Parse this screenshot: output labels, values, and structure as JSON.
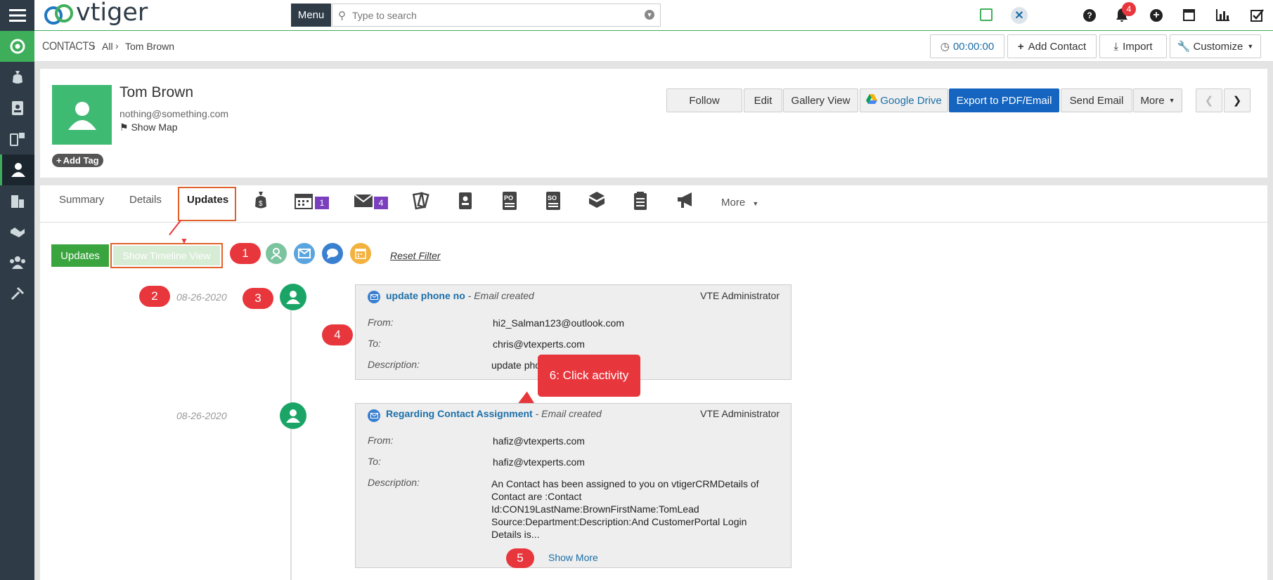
{
  "app": {
    "logo_text": "vtiger",
    "menu_label": "Menu",
    "search_placeholder": "Type to search",
    "notification_count": "4"
  },
  "header": {
    "module": "CONTACTS",
    "crumb_all": "All",
    "crumb_record": "Tom Brown",
    "timer": "00:00:00",
    "add_contact": "Add Contact",
    "import": "Import",
    "customize": "Customize"
  },
  "record": {
    "name": "Tom Brown",
    "email": "nothing@something.com",
    "show_map": "Show Map",
    "add_tag": "Add Tag"
  },
  "actions": {
    "follow": "Follow",
    "edit": "Edit",
    "gallery": "Gallery View",
    "gdrive": "Google Drive",
    "export": "Export to PDF/Email",
    "send_email": "Send Email",
    "more": "More"
  },
  "tabs": {
    "summary": "Summary",
    "details": "Details",
    "updates": "Updates",
    "calendar_badge": "1",
    "email_badge": "4",
    "more": "More"
  },
  "filters": {
    "updates": "Updates",
    "timeline": "Show Timeline View",
    "reset": "Reset Filter"
  },
  "annotations": {
    "n1": "1",
    "n2": "2",
    "n3": "3",
    "n4": "4",
    "n5": "5",
    "callout": "6: Click activity"
  },
  "timeline": [
    {
      "date": "08-26-2020",
      "title": "update phone no",
      "suffix": " - Email created",
      "owner": "VTE Administrator",
      "from_label": "From:",
      "from": "hi2_Salman123@outlook.com",
      "to_label": "To:",
      "to": "chris@vtexperts.com",
      "desc_label": "Description:",
      "desc": "update pho"
    },
    {
      "date": "08-26-2020",
      "title": "Regarding Contact Assignment",
      "suffix": " - Email created",
      "owner": "VTE Administrator",
      "from_label": "From:",
      "from": "hafiz@vtexperts.com",
      "to_label": "To:",
      "to": "hafiz@vtexperts.com",
      "desc_label": "Description:",
      "desc": "An Contact has been assigned to you on vtigerCRMDetails of Contact are :Contact Id:CON19LastName:BrownFirstName:TomLead Source:Department:Description:And CustomerPortal Login Details is...",
      "show_more": "Show More"
    }
  ],
  "colors": {
    "sidebar": "#2f3c48",
    "accent_green": "#3fae5a",
    "export_blue": "#1565c0",
    "annotation_red": "#e8363d",
    "highlight_orange": "#e0622a"
  }
}
